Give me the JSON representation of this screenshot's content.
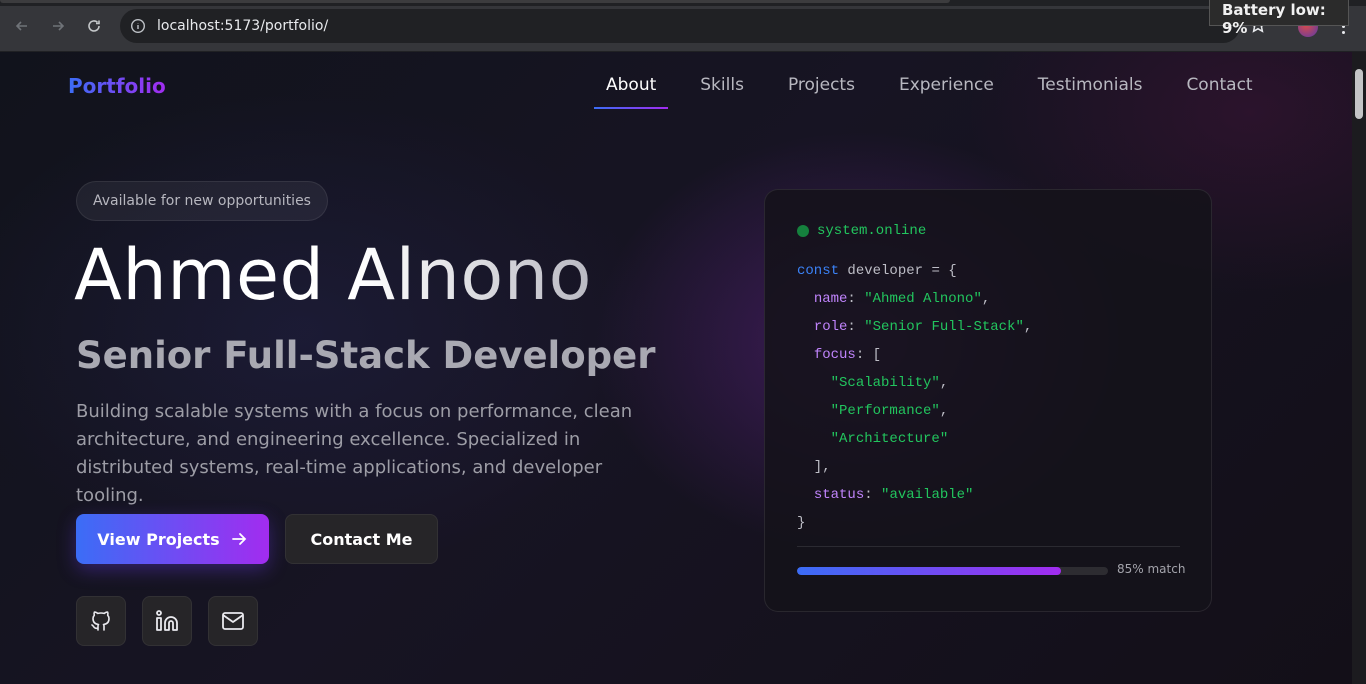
{
  "browser": {
    "url": "localhost:5173/portfolio/",
    "notification": "Battery low: 9%"
  },
  "site": {
    "logo": "Portfolio",
    "nav": [
      "About",
      "Skills",
      "Projects",
      "Experience",
      "Testimonials",
      "Contact"
    ],
    "active_nav": "About"
  },
  "hero": {
    "badge": "Available for new opportunities",
    "name": "Ahmed Alnono",
    "role": "Senior Full-Stack Developer",
    "bio": "Building scalable systems with a focus on performance, clean architecture, and engineering excellence. Specialized in distributed systems, real-time applications, and developer tooling.",
    "primary_button": "View Projects",
    "secondary_button": "Contact Me",
    "socials": [
      "github-icon",
      "linkedin-icon",
      "mail-icon"
    ]
  },
  "code_card": {
    "status": "system.online",
    "keyword": "const",
    "var_name": "developer",
    "fields": {
      "name": "\"Ahmed Alnono\"",
      "role": "\"Senior Full-Stack\"",
      "focus": [
        "\"Scalability\"",
        "\"Performance\"",
        "\"Architecture\""
      ],
      "status": "\"available\""
    },
    "match_percent": 85,
    "match_label": "85% match"
  },
  "colors": {
    "accent_start": "#3b6df6",
    "accent_end": "#a22cf0",
    "online": "#22c55e"
  }
}
